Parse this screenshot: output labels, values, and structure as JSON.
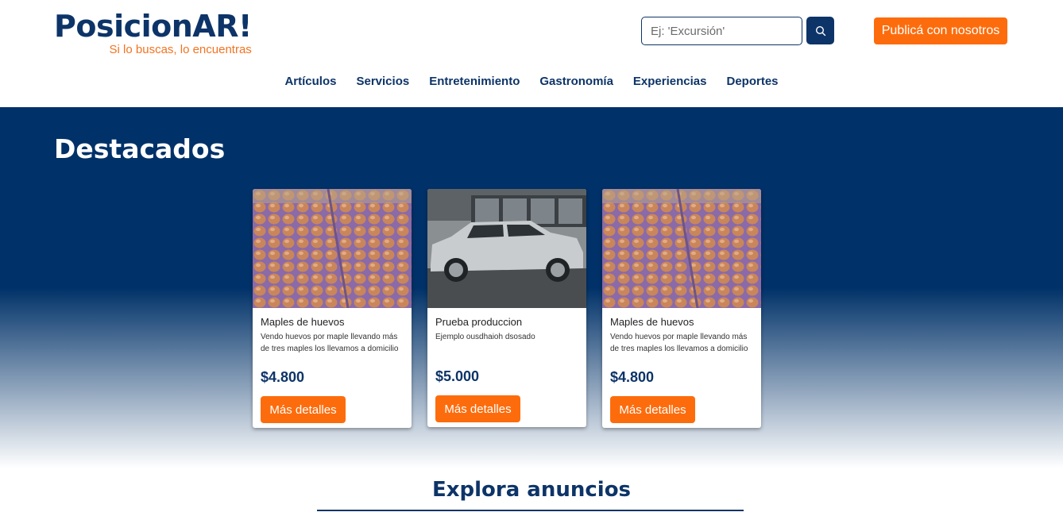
{
  "brand": {
    "title": "PosicionAR!",
    "tagline": "Si lo buscas, lo encuentras"
  },
  "search": {
    "placeholder": "Ej: 'Excursión'",
    "value": ""
  },
  "header": {
    "publish_label": "Publicá con nosotros"
  },
  "nav": {
    "items": [
      {
        "label": "Artículos"
      },
      {
        "label": "Servicios"
      },
      {
        "label": "Entretenimiento"
      },
      {
        "label": "Gastronomía"
      },
      {
        "label": "Experiencias"
      },
      {
        "label": "Deportes"
      }
    ]
  },
  "featured": {
    "title": "Destacados",
    "cards": [
      {
        "title": "Maples de huevos",
        "description": "Vendo huevos por maple llevando más de tres maples los llevamos a domicilio",
        "price": "$4.800",
        "button": "Más detalles",
        "image": "eggs-photo"
      },
      {
        "title": "Prueba produccion",
        "description": "Ejemplo ousdhaioh dsosado",
        "price": "$5.000",
        "button": "Más detalles",
        "image": "suv-photo"
      },
      {
        "title": "Maples de huevos",
        "description": "Vendo huevos por maple llevando más de tres maples los llevamos a domicilio",
        "price": "$4.800",
        "button": "Más detalles",
        "image": "eggs-photo"
      }
    ]
  },
  "explore": {
    "title": "Explora anuncios"
  },
  "colors": {
    "navy": "#0d3468",
    "orange": "#fd6c0c",
    "tagline_orange": "#f37321"
  }
}
